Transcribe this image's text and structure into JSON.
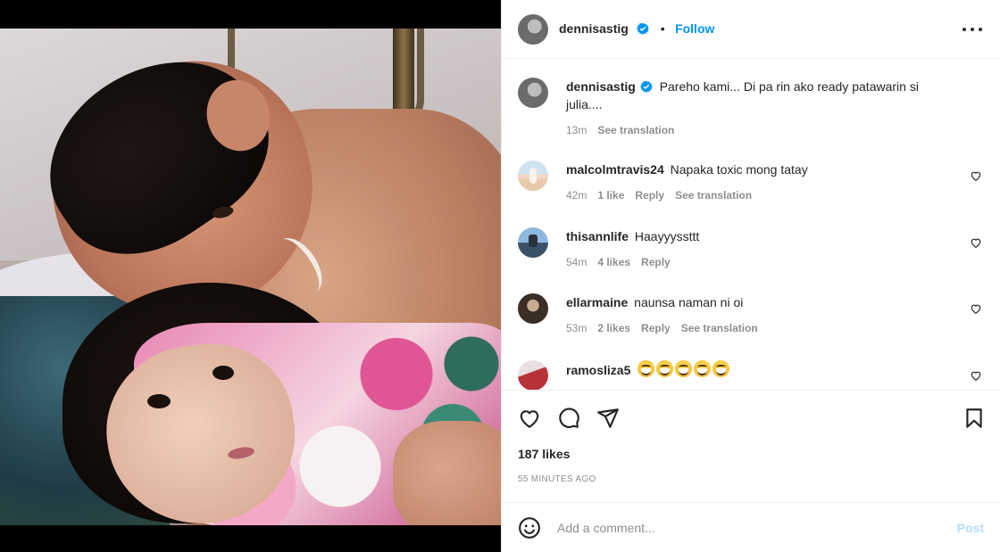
{
  "post": {
    "username": "dennisastig",
    "follow_label": "Follow",
    "separator": "•",
    "caption": "Pareho kami... Di pa rin ako ready patawarin si julia....",
    "caption_time": "13m",
    "caption_translate": "See translation",
    "likes": "187 likes",
    "posted_ago": "55 MINUTES AGO"
  },
  "comments": [
    {
      "username": "malcolmtravis24",
      "text": "Napaka toxic mong tatay",
      "time": "42m",
      "likes": "1 like",
      "reply": "Reply",
      "translate": "See translation"
    },
    {
      "username": "thisannlife",
      "text": "Haayyyssttt",
      "time": "54m",
      "likes": "4 likes",
      "reply": "Reply",
      "translate": ""
    },
    {
      "username": "ellarmaine",
      "text": "naunsa naman ni oi",
      "time": "53m",
      "likes": "2 likes",
      "reply": "Reply",
      "translate": "See translation"
    },
    {
      "username": "ramosliza5",
      "text": "😂😂😂😂😂",
      "time": "",
      "likes": "",
      "reply": "",
      "translate": ""
    }
  ],
  "composer": {
    "placeholder": "Add a comment...",
    "post_label": "Post"
  },
  "icons": {
    "more": "more-options-icon",
    "like": "heart-icon",
    "comment": "comment-bubble-icon",
    "share": "paper-plane-icon",
    "save": "bookmark-icon",
    "emoji": "emoji-icon",
    "verified": "verified-badge-icon"
  },
  "colors": {
    "accent": "#0095f6",
    "post_disabled": "#b2dffc",
    "muted": "#8e8e8e",
    "text": "#262626"
  }
}
